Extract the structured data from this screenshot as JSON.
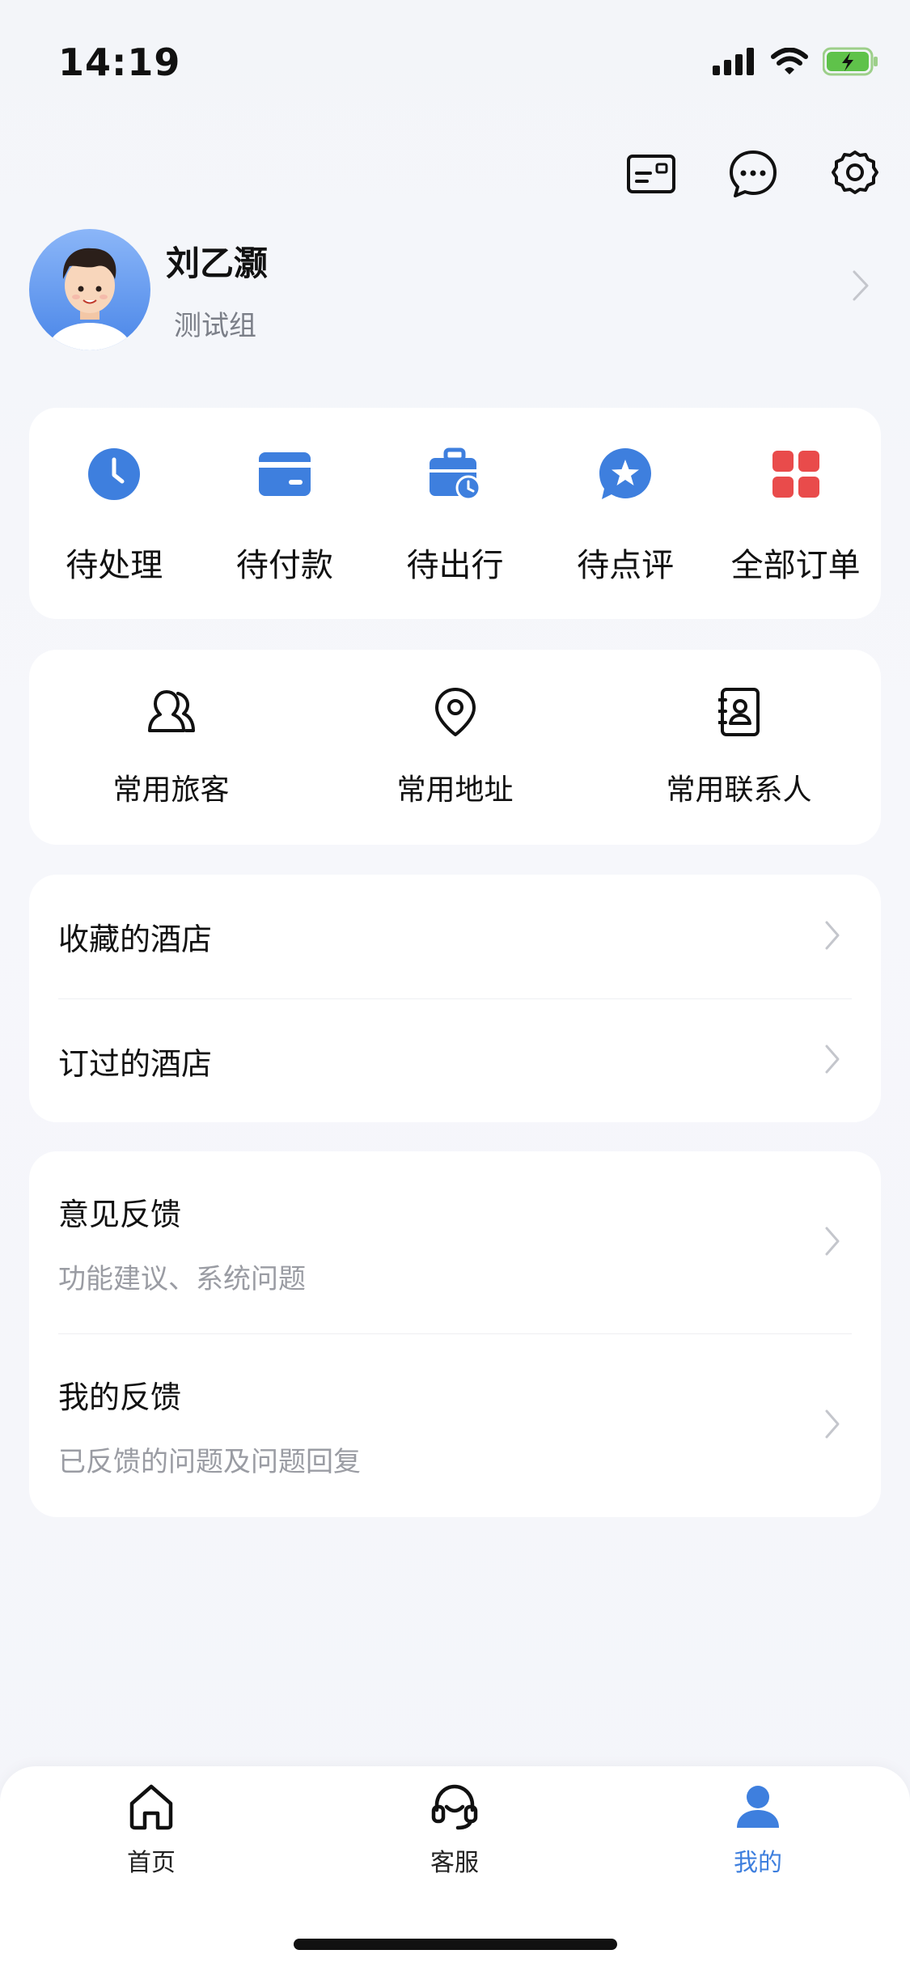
{
  "status_bar": {
    "time": "14:19"
  },
  "header_icons": [
    "card-icon",
    "chat-icon",
    "settings-icon"
  ],
  "profile": {
    "name": "刘乙灏",
    "group": "测试组"
  },
  "orders": [
    {
      "label": "待处理",
      "icon": "clock-icon"
    },
    {
      "label": "待付款",
      "icon": "card-payment-icon"
    },
    {
      "label": "待出行",
      "icon": "suitcase-icon"
    },
    {
      "label": "待点评",
      "icon": "star-badge-icon"
    },
    {
      "label": "全部订单",
      "icon": "grid-icon"
    }
  ],
  "common": [
    {
      "label": "常用旅客",
      "icon": "traveler-icon"
    },
    {
      "label": "常用地址",
      "icon": "location-pin-icon"
    },
    {
      "label": "常用联系人",
      "icon": "contact-book-icon"
    }
  ],
  "hotels": [
    {
      "label": "收藏的酒店"
    },
    {
      "label": "订过的酒店"
    }
  ],
  "feedback": [
    {
      "title": "意见反馈",
      "subtitle": "功能建议、系统问题"
    },
    {
      "title": "我的反馈",
      "subtitle": "已反馈的问题及问题回复"
    }
  ],
  "tabbar": [
    {
      "label": "首页",
      "active": false
    },
    {
      "label": "客服",
      "active": false
    },
    {
      "label": "我的",
      "active": true
    }
  ],
  "colors": {
    "accent": "#3e7fde",
    "orders_red": "#e94b4b",
    "background": "#f4f5fa"
  }
}
